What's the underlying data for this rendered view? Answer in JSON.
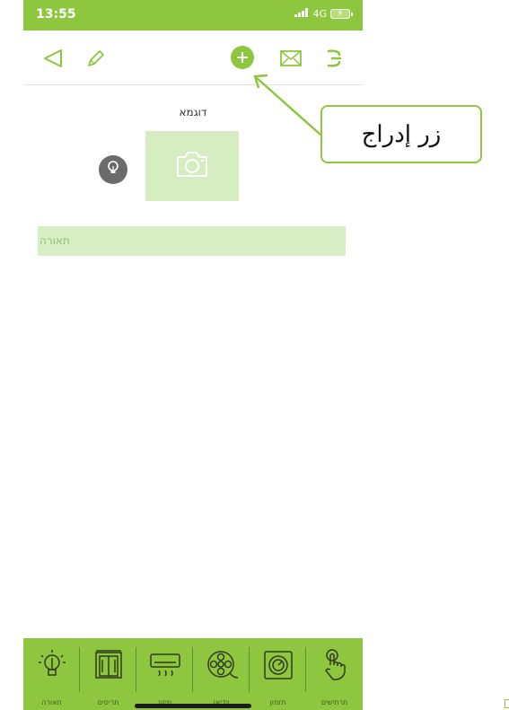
{
  "status_bar": {
    "time": "13:55",
    "network": "4G"
  },
  "navbar": {
    "back_icon": "back-triangle-icon",
    "edit_icon": "pencil-icon",
    "add_icon": "plus-circle-icon",
    "mail_icon": "envelope-icon",
    "menu_icon": "menu-icon"
  },
  "content": {
    "title": "דוגמא",
    "section_label": "תאורה"
  },
  "tabbar": {
    "items": [
      {
        "label": "תאורה",
        "icon": "lightbulb-icon"
      },
      {
        "label": "תריסים",
        "icon": "shutters-icon"
      },
      {
        "label": "מיזוג",
        "icon": "air-conditioner-icon"
      },
      {
        "label": "וידיאו",
        "icon": "film-reel-icon"
      },
      {
        "label": "תזמון",
        "icon": "timer-icon"
      },
      {
        "label": "תרחישים",
        "icon": "touch-hand-icon"
      }
    ]
  },
  "annotation": {
    "callout_text": "زر إدراج"
  },
  "colors": {
    "accent": "#8fc63f",
    "light_accent": "#d6ecc1",
    "badge": "#6b6b6b"
  }
}
